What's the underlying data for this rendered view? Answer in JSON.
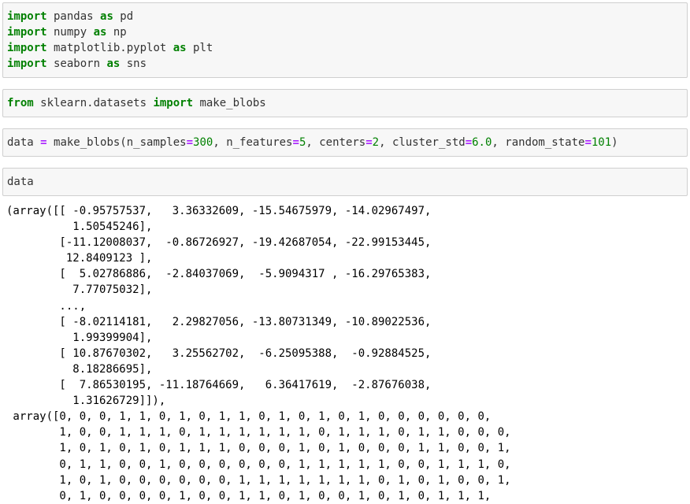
{
  "cells": [
    {
      "lines": [
        [
          {
            "t": "import",
            "c": "kw"
          },
          {
            "t": " pandas "
          },
          {
            "t": "as",
            "c": "kw"
          },
          {
            "t": " pd"
          }
        ],
        [
          {
            "t": "import",
            "c": "kw"
          },
          {
            "t": " numpy "
          },
          {
            "t": "as",
            "c": "kw"
          },
          {
            "t": " np"
          }
        ],
        [
          {
            "t": "import",
            "c": "kw"
          },
          {
            "t": " matplotlib.pyplot "
          },
          {
            "t": "as",
            "c": "kw"
          },
          {
            "t": " plt"
          }
        ],
        [
          {
            "t": "import",
            "c": "kw"
          },
          {
            "t": " seaborn "
          },
          {
            "t": "as",
            "c": "kw"
          },
          {
            "t": " sns"
          }
        ]
      ]
    },
    {
      "lines": [
        [
          {
            "t": "from",
            "c": "kw"
          },
          {
            "t": " sklearn.datasets "
          },
          {
            "t": "import",
            "c": "kw"
          },
          {
            "t": " make_blobs"
          }
        ]
      ]
    },
    {
      "lines": [
        [
          {
            "t": "data "
          },
          {
            "t": "=",
            "c": "op"
          },
          {
            "t": " make_blobs(n_samples"
          },
          {
            "t": "=",
            "c": "op"
          },
          {
            "t": "300",
            "c": "num"
          },
          {
            "t": ", n_features"
          },
          {
            "t": "=",
            "c": "op"
          },
          {
            "t": "5",
            "c": "num"
          },
          {
            "t": ", centers"
          },
          {
            "t": "=",
            "c": "op"
          },
          {
            "t": "2",
            "c": "num"
          },
          {
            "t": ", cluster_std"
          },
          {
            "t": "=",
            "c": "op"
          },
          {
            "t": "6.0",
            "c": "num"
          },
          {
            "t": ", random_state"
          },
          {
            "t": "=",
            "c": "op"
          },
          {
            "t": "101",
            "c": "num"
          },
          {
            "t": ")"
          }
        ]
      ]
    },
    {
      "lines": [
        [
          {
            "t": "data"
          }
        ]
      ]
    }
  ],
  "output_lines": [
    "(array([[ -0.95757537,   3.36332609, -15.54675979, -14.02967497,",
    "          1.50545246],",
    "        [-11.12008037,  -0.86726927, -19.42687054, -22.99153445,",
    "         12.8409123 ],",
    "        [  5.02786886,  -2.84037069,  -5.9094317 , -16.29765383,",
    "          7.77075032],",
    "        ...,",
    "        [ -8.02114181,   2.29827056, -13.80731349, -10.89022536,",
    "          1.99399904],",
    "        [ 10.87670302,   3.25562702,  -6.25095388,  -0.92884525,",
    "          8.18286695],",
    "        [  7.86530195, -11.18764669,   6.36417619,  -2.87676038,",
    "          1.31626729]]),",
    " array([0, 0, 0, 1, 1, 0, 1, 0, 1, 1, 0, 1, 0, 1, 0, 1, 0, 0, 0, 0, 0, 0,",
    "        1, 0, 0, 1, 1, 1, 0, 1, 1, 1, 1, 1, 1, 0, 1, 1, 1, 0, 1, 1, 0, 0, 0,",
    "        1, 0, 1, 0, 1, 0, 1, 1, 1, 0, 0, 0, 1, 0, 1, 0, 0, 0, 1, 1, 0, 0, 1,",
    "        0, 1, 1, 0, 0, 1, 0, 0, 0, 0, 0, 0, 1, 1, 1, 1, 1, 0, 0, 1, 1, 1, 0,",
    "        1, 0, 1, 0, 0, 0, 0, 0, 0, 1, 1, 1, 1, 1, 1, 1, 0, 1, 0, 1, 0, 0, 1,",
    "        0, 1, 0, 0, 0, 0, 1, 0, 0, 1, 1, 0, 1, 0, 0, 1, 0, 1, 0, 1, 1, 1,"
  ]
}
